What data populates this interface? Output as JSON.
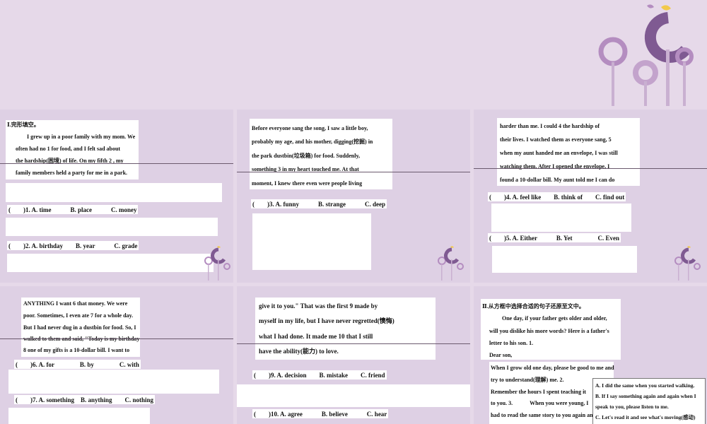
{
  "slides": {
    "s1": {
      "heading": "Ⅰ.完形填空。",
      "lines": [
        "I grew up in a poor family with my mom. We",
        "often had no  1  for food, and I felt sad about",
        "the hardship(困境) of life. On my fifth  2  , my",
        "family members held a party for me in a park."
      ],
      "q1": "(　　)1. A. time　　　B. place　　　C. money",
      "q2": "(　　)2. A. birthday　　B. year　　　C. grade"
    },
    "s2": {
      "lines": [
        "Before everyone sang the song, I saw a little boy,",
        "probably my age, and his mother, digging(挖掘) in",
        "the park dustbin(垃圾箱) for food. Suddenly,",
        "something  3  in my heart touched me. At that",
        "moment, I knew there even were people living"
      ],
      "q3": "(　　)3. A. funny　　　B. strange　　　C. deep"
    },
    "s3": {
      "lines": [
        "harder than me. I could  4  the hardship of",
        "their lives. I watched them as everyone sang,  5",
        "when my aunt handed me an envelope, I was still",
        "watching them. After I opened the envelope, I",
        "found a 10-dollar bill. My aunt told me I can do"
      ],
      "q4": "(　　)4. A. feel like　　B. think of　　C. find out",
      "q5": "(　　)5. A. Either　　　B. Yet　　　　C. Even"
    },
    "s4": {
      "lines": [
        "ANYTHING I want  6  that money. We were",
        "poor. Sometimes, I even ate  7  for a whole day.",
        "But I had never dug in a dustbin for food. So, I",
        "walked to them and said, \"Today is my birthday",
        " 8  one of my gifts is a 10-dollar bill. I want to"
      ],
      "q6": "(　　)6. A. for　　　　B. by　　　　C. with",
      "q7": "(　　)7. A. something　B. anything　　C. nothing"
    },
    "s5": {
      "lines": [
        "give it to you.\" That was the first  9  made by",
        "myself in my life, but I have never regretted(懊悔)",
        "what I had done. It made me  10  that I still",
        "have the ability(能力) to love."
      ],
      "q9": "(　　)9. A. decision　　B. mistake　　C. friend",
      "q10": "(　　)10. A. agree　　　B. believe　　　C. hear"
    },
    "s6": {
      "heading": "Ⅱ.从方框中选择合适的句子还原至文中。",
      "lines": [
        "One day, if your father gets older and older,",
        "will you dislike his more words? Here is a father's",
        "letter to his son. 1.",
        "Dear son,"
      ],
      "letter": [
        "When I grow old one day, please be good to me and",
        "try to understand(理解) me. 2.",
        "Remember the hours I spent teaching it",
        "to you. 3.　　　When you were young, I",
        "had to read the same story to you again and"
      ],
      "options": [
        "A. I did the same when you started walking.",
        "B. If I say something again and again when I",
        "   speak to you, please listen to me.",
        "C. Let's read it and see what's moving(感动) you."
      ]
    }
  }
}
